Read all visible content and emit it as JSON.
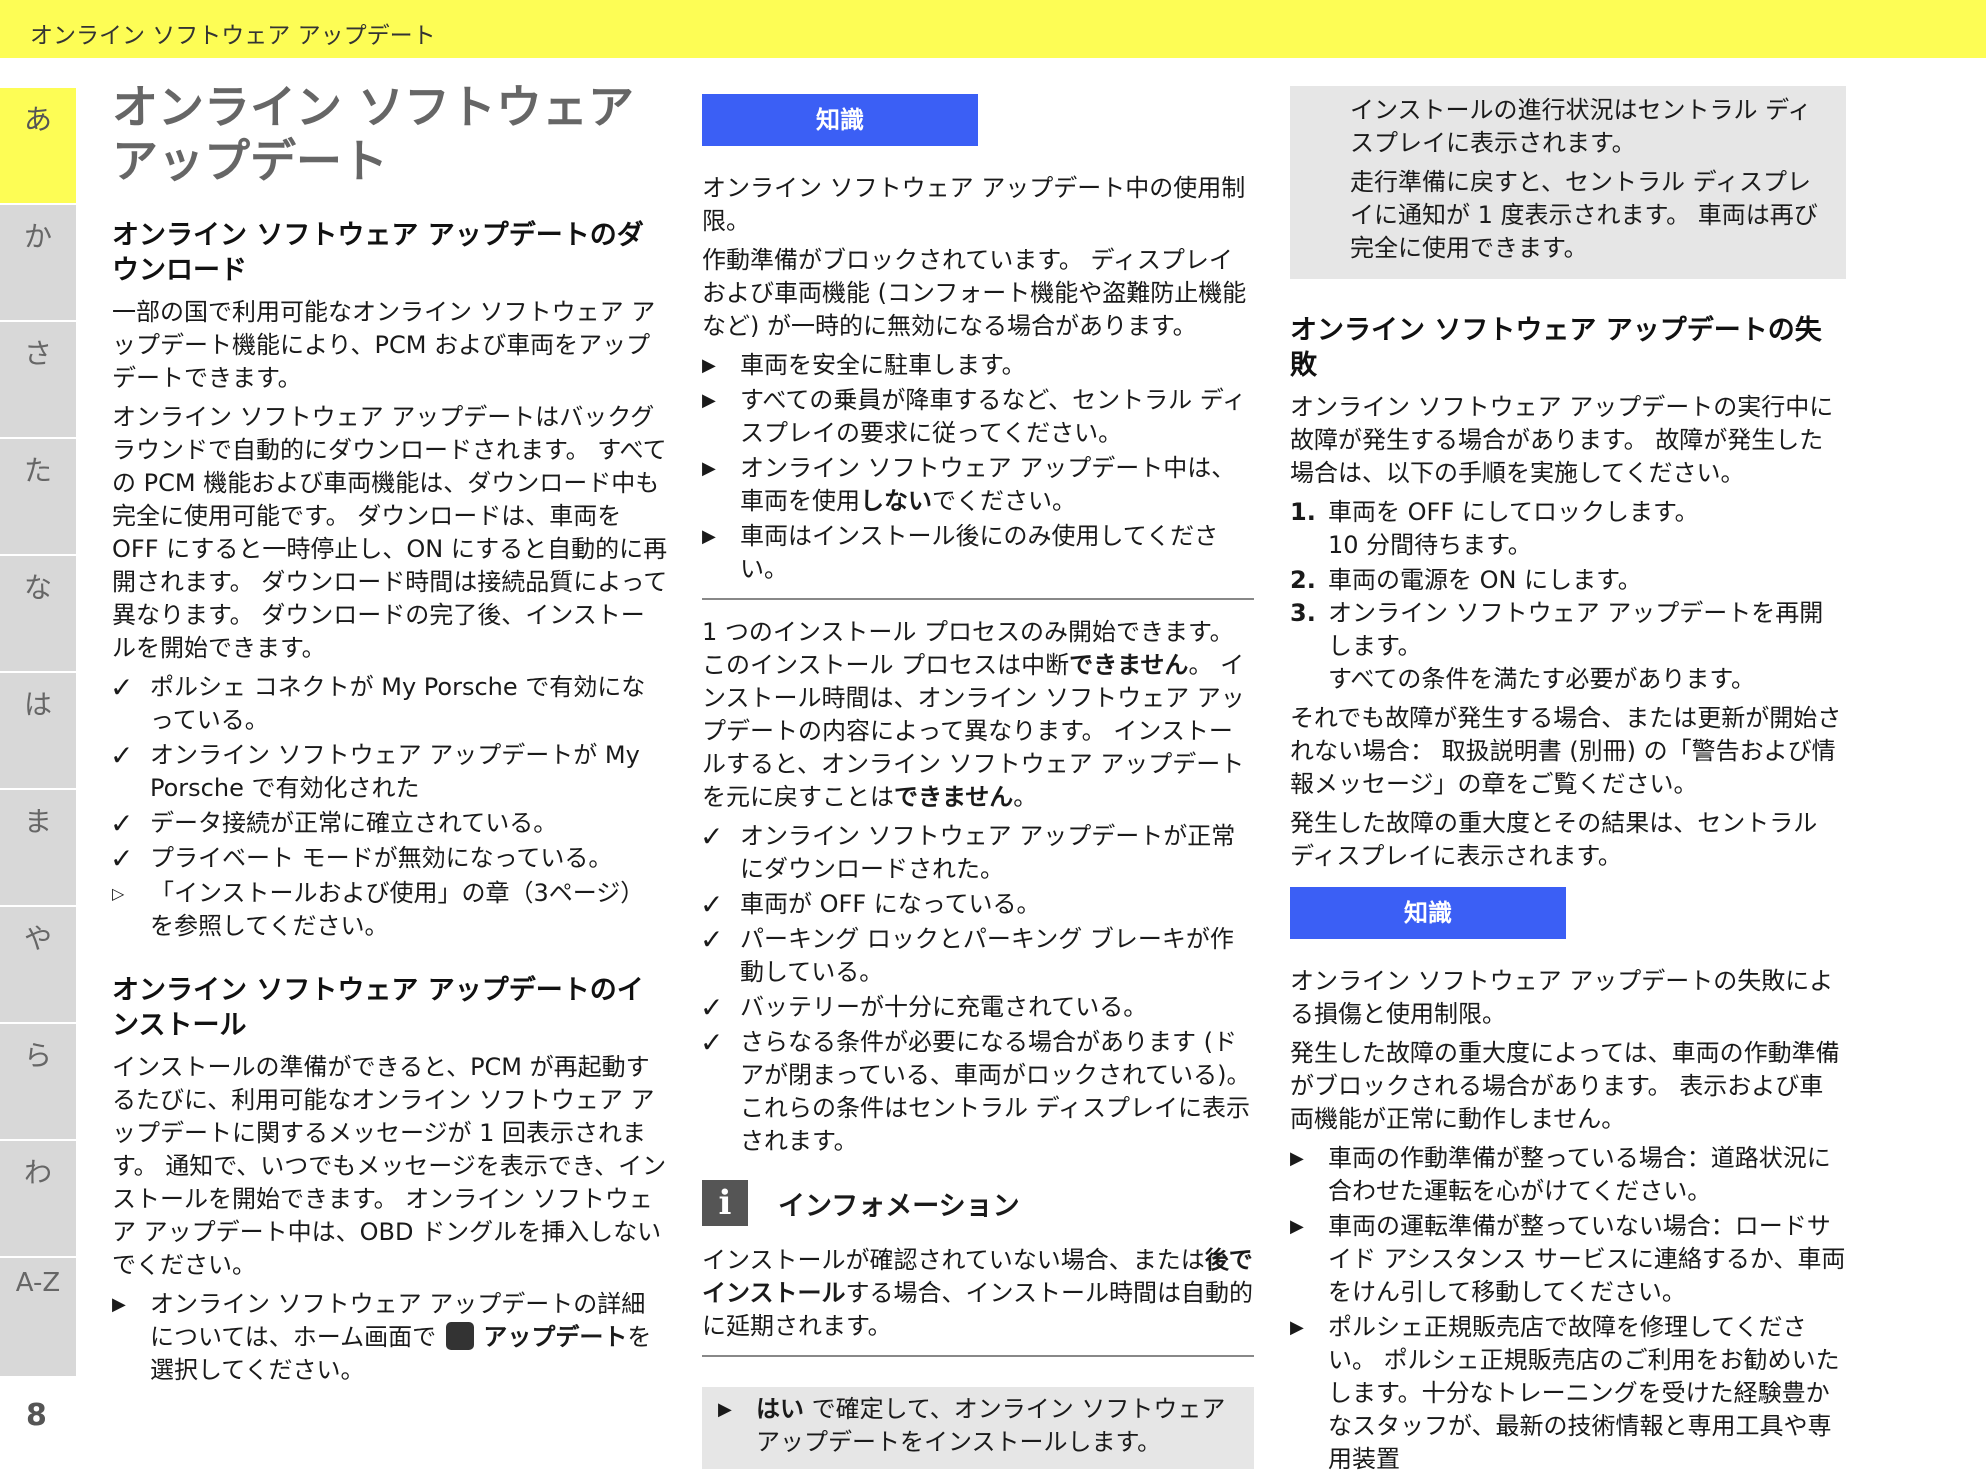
{
  "header": {
    "title": "オンライン ソフトウェア アップデート"
  },
  "sidebar": {
    "tabs": [
      {
        "label": "あ"
      },
      {
        "label": "か"
      },
      {
        "label": "さ"
      },
      {
        "label": "た"
      },
      {
        "label": "な"
      },
      {
        "label": "は"
      },
      {
        "label": "ま"
      },
      {
        "label": "や"
      },
      {
        "label": "ら"
      },
      {
        "label": "わ"
      },
      {
        "label": "A-Z"
      }
    ],
    "page_number": "8"
  },
  "col1": {
    "title": "オンライン ソフトウェア アップデート",
    "download": {
      "heading": "オンライン ソフトウェア アップデートのダウンロード",
      "p1": "一部の国で利用可能なオンライン ソフトウェア アップデート機能により、PCM および車両をアップデートできます。",
      "p2": "オンライン ソフトウェア アップデートはバックグラウンドで自動的にダウンロードされます。 すべての PCM 機能および車両機能は、ダウンロード中も完全に使用可能です。 ダウンロードは、車両を OFF にすると一時停止し、ON にすると自動的に再開されます。 ダウンロード時間は接続品質によって異なります。 ダウンロードの完了後、インストールを開始できます。",
      "checks": [
        "ポルシェ コネクトが My Porsche で有効になっている。",
        "オンライン ソフトウェア アップデートが My Porsche で有効化された",
        "データ接続が正常に確立されている。",
        "プライベート モードが無効になっている。"
      ],
      "ref": "「インストールおよび使用」の章（3ページ）を参照してください。"
    },
    "install": {
      "heading": "オンライン ソフトウェア アップデートのインストール",
      "p1": "インストールの準備ができると、PCM が再起動するたびに、利用可能なオンライン ソフトウェア アップデートに関するメッセージが 1 回表示されます。 通知で、いつでもメッセージを表示でき、インストールを開始できます。 オンライン ソフトウェア アップデート中は、OBD ドングルを挿入しないでください。",
      "bullet_pre": "オンライン ソフトウェア アップデートの詳細については、ホーム画面で",
      "bullet_bold": "アップデート",
      "bullet_post": "を選択してください。"
    }
  },
  "col2": {
    "knowledge_label": "知識",
    "p1": "オンライン ソフトウェア アップデート中の使用制限。",
    "p2": "作動準備がブロックされています。 ディスプレイおよび車両機能 (コンフォート機能や盗難防止機能など) が一時的に無効になる場合があります。",
    "bullet1": "車両を安全に駐車します。",
    "bullet2": "すべての乗員が降車するなど、セントラル ディスプレイの要求に従ってください。",
    "bullet3_pre": "オンライン ソフトウェア アップデート中は、車両を使用",
    "bullet3_bold": "しない",
    "bullet3_post": "でください。",
    "bullet4": "車両はインストール後にのみ使用してください。",
    "p3_a": "1 つのインストール プロセスのみ開始できます。 このインストール プロセスは中断",
    "p3_b1": "できません",
    "p3_c": "。 インストール時間は、オンライン ソフトウェア アップデートの内容によって異なります。 インストールすると、オンライン ソフトウェア アップデートを元に戻すことは",
    "p3_b2": "できません",
    "p3_d": "。",
    "checks": [
      "オンライン ソフトウェア アップデートが正常にダウンロードされた。",
      "車両が OFF になっている。",
      "パーキング ロックとパーキング ブレーキが作動している。",
      "バッテリーが十分に充電されている。",
      "さらなる条件が必要になる場合があります (ドアが閉まっている、車両がロックされている)。これらの条件はセントラル ディスプレイに表示されます。"
    ],
    "info_title": "インフォメーション",
    "info_p_pre": "インストールが確認されていない場合、または",
    "info_p_bold": "後でインストール",
    "info_p_post": "する場合、インストール時間は自動的に延期されます。",
    "confirm_bold": "はい",
    "confirm_rest": " で確定して、オンライン ソフトウェア アップデートをインストールします。"
  },
  "col3": {
    "box_p1": "インストールの進行状況はセントラル ディスプレイに表示されます。",
    "box_p2": "走行準備に戻すと、セントラル ディスプレイに通知が 1 度表示されます。 車両は再び完全に使用できます。",
    "fail_heading": "オンライン ソフトウェア アップデートの失敗",
    "fail_p1": "オンライン ソフトウェア アップデートの実行中に故障が発生する場合があります。 故障が発生した場合は、以下の手順を実施してください。",
    "steps": [
      {
        "num": "1.",
        "text": "車両を OFF にしてロックします。",
        "sub": "10 分間待ちます。"
      },
      {
        "num": "2.",
        "text": "車両の電源を ON にします。",
        "sub": ""
      },
      {
        "num": "3.",
        "text": "オンライン ソフトウェア アップデートを再開します。",
        "sub": "すべての条件を満たす必要があります。"
      }
    ],
    "fail_p2": "それでも故障が発生する場合、または更新が開始されない場合： 取扱説明書 (別冊) の「警告および情報メッセージ」の章をご覧ください。",
    "fail_p3": "発生した故障の重大度とその結果は、セントラル ディスプレイに表示されます。",
    "knowledge_label": "知識",
    "k_p1": "オンライン ソフトウェア アップデートの失敗による損傷と使用制限。",
    "k_p2": "発生した故障の重大度によっては、車両の作動準備がブロックされる場合があります。 表示および車両機能が正常に動作しません。",
    "k_bullets": [
      "車両の作動準備が整っている場合：道路状況に合わせた運転を心がけてください。",
      "車両の運転準備が整っていない場合：ロードサイド アシスタンス サービスに連絡するか、車両をけん引して移動してください。",
      "ポルシェ正規販売店で故障を修理してください。 ポルシェ正規販売店のご利用をお勧めいたします。十分なトレーニングを受けた経験豊かなスタッフが、最新の技術情報と専用工具や専用装置"
    ]
  }
}
